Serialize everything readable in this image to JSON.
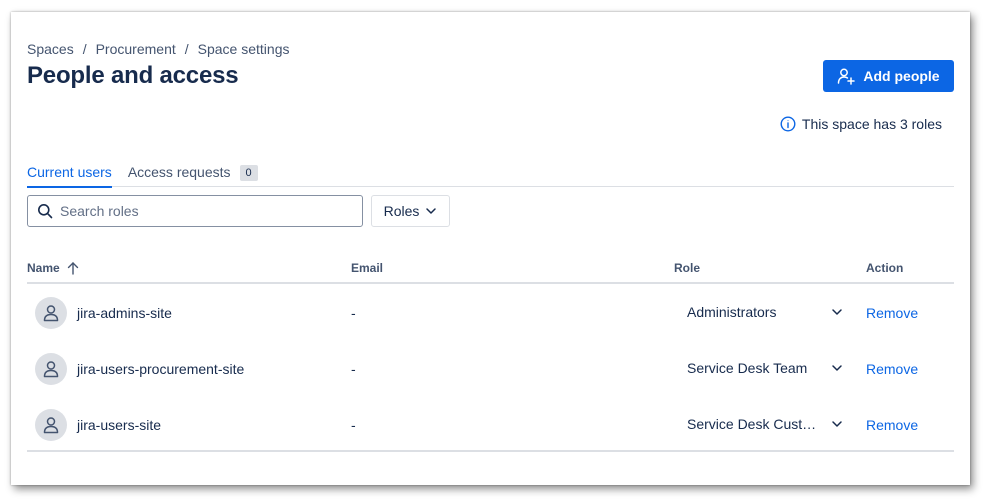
{
  "breadcrumb": [
    "Spaces",
    "Procurement",
    "Space settings"
  ],
  "breadcrumb_separator": "/",
  "page_title": "People and access",
  "add_people_label": "Add people",
  "info_text": "This space has 3 roles",
  "tabs": [
    {
      "label": "Current users",
      "active": true
    },
    {
      "label": "Access requests",
      "badge": "0"
    }
  ],
  "search": {
    "placeholder": "Search roles",
    "value": ""
  },
  "roles_filter_label": "Roles",
  "table": {
    "headers": {
      "name": "Name",
      "email": "Email",
      "role": "Role",
      "action": "Action"
    },
    "sort": {
      "column": "Name",
      "direction": "ascending"
    },
    "rows": [
      {
        "name": "jira-admins-site",
        "email": "-",
        "role": "Administrators",
        "action": "Remove"
      },
      {
        "name": "jira-users-procurement-site",
        "email": "-",
        "role": "Service Desk Team",
        "action": "Remove"
      },
      {
        "name": "jira-users-site",
        "email": "-",
        "role": "Service Desk Customers",
        "action": "Remove"
      }
    ]
  },
  "icons": {
    "add_people": "person-add-icon",
    "info": "info-icon",
    "search": "search-icon",
    "dropdown": "chevron-down-icon",
    "sort": "arrow-up-icon",
    "avatar": "person-icon"
  },
  "colors": {
    "primary": "#0c66e4",
    "text": "#172b4d",
    "subtle_text": "#44546f",
    "border": "#dcdfe4",
    "avatar_bg": "#dcdfe4"
  }
}
